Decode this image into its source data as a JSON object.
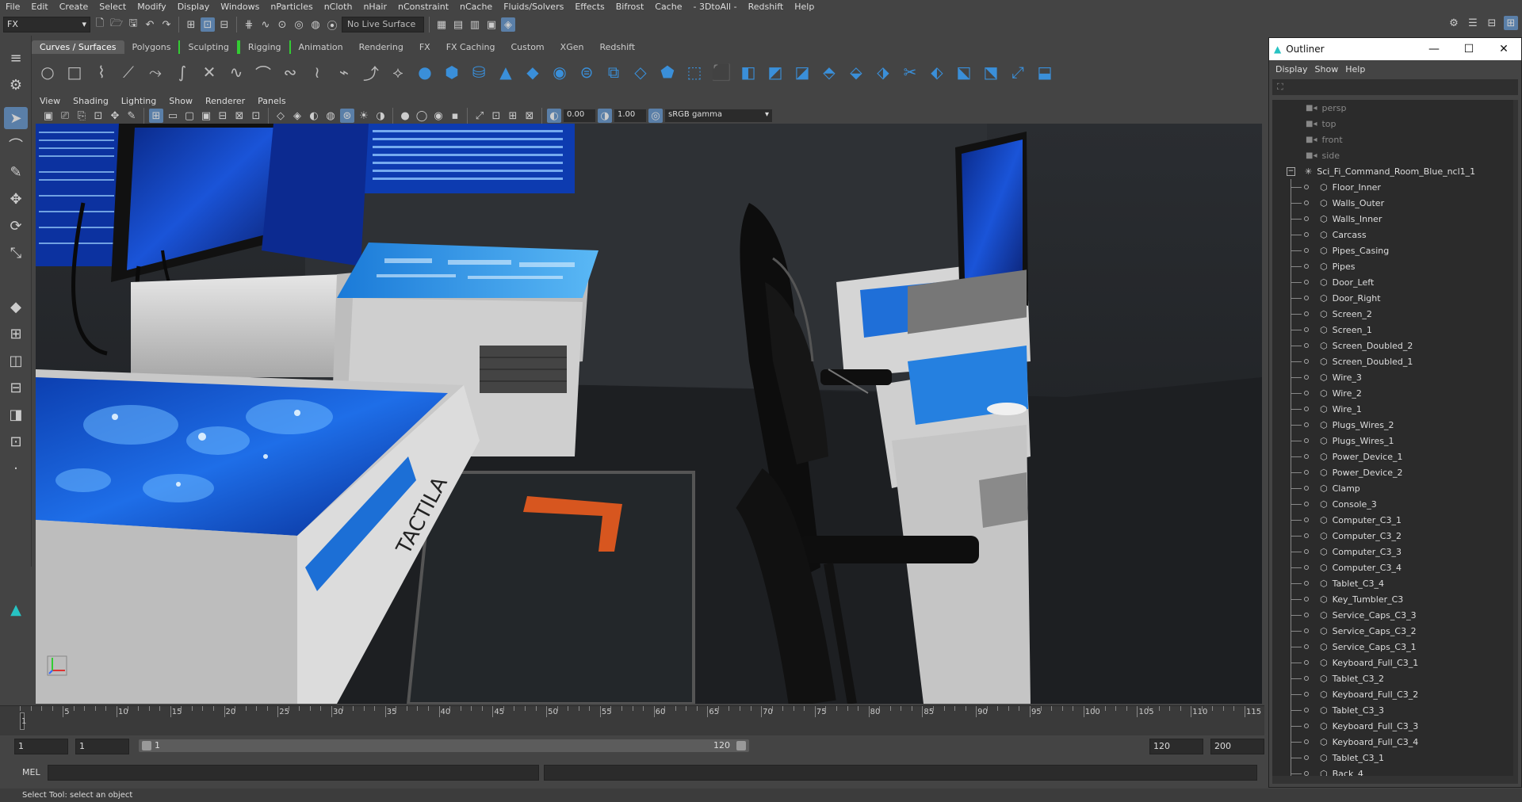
{
  "menubar": [
    "File",
    "Edit",
    "Create",
    "Select",
    "Modify",
    "Display",
    "Windows",
    "nParticles",
    "nCloth",
    "nHair",
    "nConstraint",
    "nCache",
    "Fluids/Solvers",
    "Effects",
    "Bifrost",
    "Cache",
    "- 3DtoAll -",
    "Redshift",
    "Help"
  ],
  "status": {
    "menuset": "FX",
    "live_surface": "No Live Surface"
  },
  "shelf": {
    "tabs": [
      "Curves / Surfaces",
      "Polygons",
      "Sculpting",
      "Rigging",
      "Animation",
      "Rendering",
      "FX",
      "FX Caching",
      "Custom",
      "XGen",
      "Redshift"
    ],
    "active_tab": "Curves / Surfaces"
  },
  "viewport": {
    "menu": [
      "View",
      "Shading",
      "Lighting",
      "Show",
      "Renderer",
      "Panels"
    ],
    "exposure": "0.00",
    "gamma": "1.00",
    "color_space": "sRGB gamma",
    "camera": "persp",
    "scene_text": "TACTILA"
  },
  "timeline": {
    "ticks": [
      "5",
      "10",
      "15",
      "20",
      "25",
      "30",
      "35",
      "40",
      "45",
      "50",
      "55",
      "60",
      "65",
      "70",
      "75",
      "80",
      "85",
      "90",
      "95",
      "100",
      "105",
      "110",
      "115"
    ],
    "current": "1"
  },
  "range": {
    "start": "1",
    "start2": "1",
    "slider_start": "1",
    "slider_end": "120",
    "end": "120",
    "max": "200"
  },
  "cmdline": {
    "label": "MEL"
  },
  "helpline": "Select Tool: select an object",
  "outliner": {
    "title": "Outliner",
    "menu": [
      "Display",
      "Show",
      "Help"
    ],
    "cameras": [
      "persp",
      "top",
      "front",
      "side"
    ],
    "root": "Sci_Fi_Command_Room_Blue_ncl1_1",
    "children": [
      "Floor_Inner",
      "Walls_Outer",
      "Walls_Inner",
      "Carcass",
      "Pipes_Casing",
      "Pipes",
      "Door_Left",
      "Door_Right",
      "Screen_2",
      "Screen_1",
      "Screen_Doubled_2",
      "Screen_Doubled_1",
      "Wire_3",
      "Wire_2",
      "Wire_1",
      "Plugs_Wires_2",
      "Plugs_Wires_1",
      "Power_Device_1",
      "Power_Device_2",
      "Clamp",
      "Console_3",
      "Computer_C3_1",
      "Computer_C3_2",
      "Computer_C3_3",
      "Computer_C3_4",
      "Tablet_C3_4",
      "Key_Tumbler_C3",
      "Service_Caps_C3_3",
      "Service_Caps_C3_2",
      "Service_Caps_C3_1",
      "Keyboard_Full_C3_1",
      "Tablet_C3_2",
      "Keyboard_Full_C3_2",
      "Tablet_C3_3",
      "Keyboard_Full_C3_3",
      "Keyboard_Full_C3_4",
      "Tablet_C3_1",
      "Back_4"
    ]
  }
}
